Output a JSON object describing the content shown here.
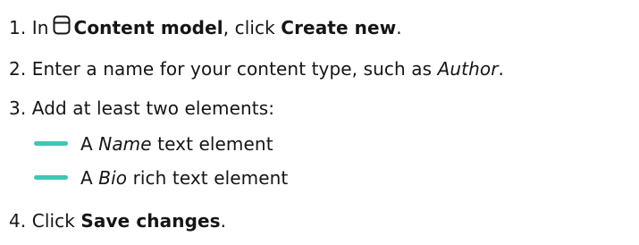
{
  "steps": [
    {
      "number": "1.",
      "pre": "In",
      "icon": "content-model-icon",
      "bold1": "Content model",
      "mid": ", click",
      "bold2": "Create new",
      "end": "."
    },
    {
      "number": "2.",
      "text": "Enter a name for your content type, such as",
      "italic": "Author",
      "end": "."
    },
    {
      "number": "3.",
      "text": "Add at least two elements:"
    },
    {
      "number": "4.",
      "pre": "Click",
      "bold": "Save changes",
      "end": "."
    }
  ],
  "sub_items": [
    {
      "pre": "A",
      "italic": "Name",
      "post": "text element"
    },
    {
      "pre": "A",
      "italic": "Bio",
      "post": "rich text element"
    }
  ],
  "colors": {
    "text": "#151515",
    "dash_accent": "#3ec7b3"
  }
}
